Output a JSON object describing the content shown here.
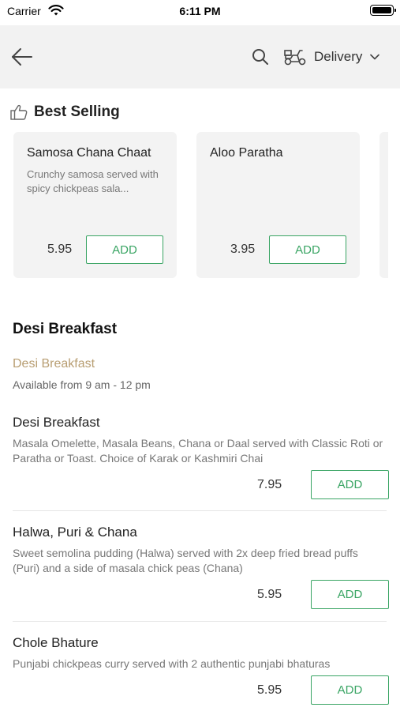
{
  "status_bar": {
    "carrier": "Carrier",
    "time": "6:11 PM"
  },
  "header": {
    "delivery_label": "Delivery"
  },
  "best_selling": {
    "title": "Best Selling",
    "items": [
      {
        "name": "Samosa Chana Chaat",
        "description": "Crunchy samosa served with spicy chickpeas sala...",
        "price": "5.95",
        "add_label": "ADD"
      },
      {
        "name": "Aloo Paratha",
        "description": "",
        "price": "3.95",
        "add_label": "ADD"
      }
    ]
  },
  "category": {
    "title": "Desi Breakfast",
    "subtitle": "Desi Breakfast",
    "availability": "Available from 9 am - 12 pm",
    "items": [
      {
        "name": "Desi Breakfast",
        "description": "Masala Omelette, Masala Beans, Chana or Daal served with Classic Roti or Paratha or Toast. Choice of Karak or Kashmiri Chai",
        "price": "7.95",
        "add_label": "ADD"
      },
      {
        "name": "Halwa, Puri & Chana",
        "description": "Sweet semolina pudding (Halwa) served with 2x deep fried bread puffs (Puri) and a side of masala chick peas (Chana)",
        "price": "5.95",
        "add_label": "ADD"
      },
      {
        "name": "Chole Bhature",
        "description": "Punjabi chickpeas curry served with 2 authentic punjabi bhaturas",
        "price": "5.95",
        "add_label": "ADD"
      }
    ]
  },
  "colors": {
    "accent_green": "#3aa564",
    "subtitle_gold": "#b89e72",
    "header_bg": "#f2f2f2"
  },
  "icons": [
    "wifi-icon",
    "battery-icon",
    "back-arrow-icon",
    "search-icon",
    "scooter-icon",
    "chevron-down-icon",
    "thumbs-up-icon"
  ]
}
